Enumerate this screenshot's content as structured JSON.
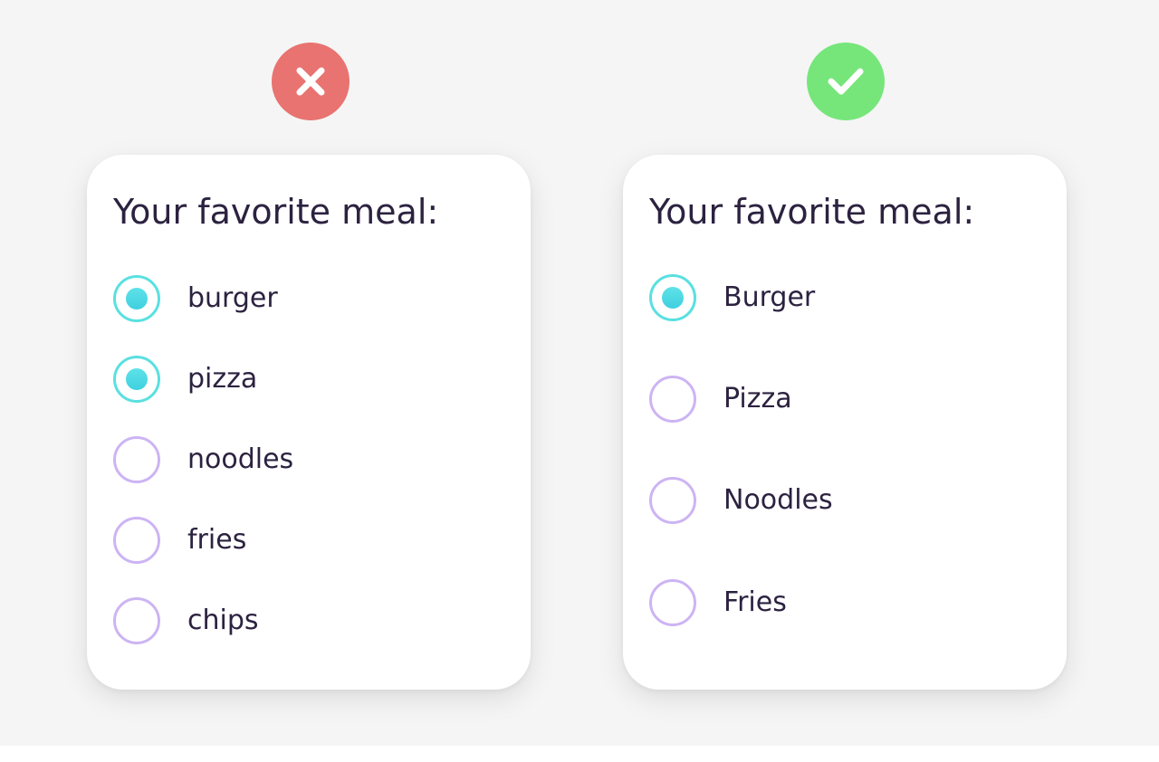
{
  "bad_example": {
    "badge_icon": "close-icon",
    "badge_color": "#e87370",
    "title": "Your favorite meal:",
    "options": [
      {
        "label": "burger",
        "selected": true
      },
      {
        "label": "pizza",
        "selected": true
      },
      {
        "label": "noodles",
        "selected": false
      },
      {
        "label": "fries",
        "selected": false
      },
      {
        "label": "chips",
        "selected": false
      }
    ]
  },
  "good_example": {
    "badge_icon": "checkmark-icon",
    "badge_color": "#76e67b",
    "title": "Your favorite meal:",
    "options": [
      {
        "label": "Burger",
        "selected": true
      },
      {
        "label": "Pizza",
        "selected": false
      },
      {
        "label": "Noodles",
        "selected": false
      },
      {
        "label": "Fries",
        "selected": false
      }
    ]
  },
  "colors": {
    "selected_ring": "#5ae0e0",
    "unselected_ring": "#cdb4f3",
    "text": "#2c2240",
    "background": "#f5f5f5"
  }
}
